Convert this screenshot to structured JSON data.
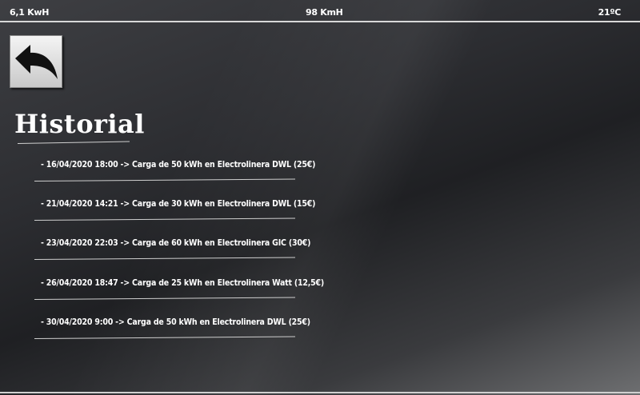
{
  "status": {
    "energy": "6,1 KwH",
    "speed": "98 KmH",
    "temperature": "21ºC"
  },
  "navigation": {
    "back_icon": "back-arrow-icon"
  },
  "page": {
    "title": "Historial"
  },
  "history": [
    {
      "text": "- 16/04/2020 18:00  -> Carga de 50 kWh en Electrolinera DWL  (25€)"
    },
    {
      "text": "- 21/04/2020 14:21  -> Carga de 30 kWh en Electrolinera DWL (15€)"
    },
    {
      "text": "- 23/04/2020 22:03  -> Carga de 60 kWh en Electrolinera GIC (30€)"
    },
    {
      "text": "- 26/04/2020 18:47  -> Carga de 25 kWh en Electrolinera Watt (12,5€)"
    },
    {
      "text": "- 30/04/2020 9:00  -> Carga de 50 kWh en Electrolinera DWL (25€)"
    }
  ]
}
